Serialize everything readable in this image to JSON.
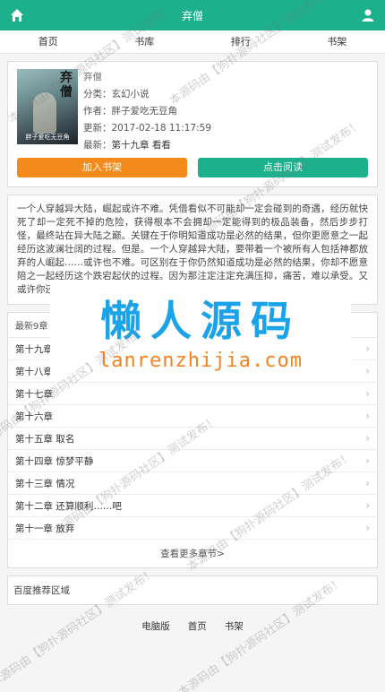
{
  "header": {
    "title": "弃僧",
    "home_icon": "home-icon",
    "user_icon": "user-icon"
  },
  "nav": {
    "items": [
      {
        "label": "首页"
      },
      {
        "label": "书库"
      },
      {
        "label": "排行"
      },
      {
        "label": "书架"
      }
    ]
  },
  "book": {
    "cover_title": "弃僧",
    "cover_author": "胖子爱吃无豆角",
    "name": "弃僧",
    "category": "分类：玄幻小说",
    "author": "作者：胖子爱吃无豆角",
    "updated": "更新：2017-02-18 11:17:59",
    "latest_label": "最新：",
    "latest_chapter": "第十九章 看看",
    "btn_add_shelf": "加入书架",
    "btn_read": "点击阅读"
  },
  "intro": "一个人穿越异大陆，崛起或许不难。凭借看似不可能却一定会碰到的奇遇，经历就快死了却一定死不掉的危险，获得根本不会拥却一定能得到的极品装备，然后步步打怪，最终站在异大陆之巅。关键在于你明知道成功是必然的结果，但你更愿意之一起经历这波澜壮阔的过程。但是。一个人穿越异大陆，要带着一个被所有人包括神都放弃的人崛起……或许也不难。可区别在于你仍然知道成功是必然的结果，你却不愿意陪之一起经历这个跌宕起伏的过程。因为那注定注定充满压抑，痛苦，难以承受。又或许你还是愿将精力情感投入这样一本不值得？那么，要不要试试呢？",
  "chapters": {
    "head": "最新9章",
    "items": [
      {
        "title": "第十九章 看看"
      },
      {
        "title": "第十八章"
      },
      {
        "title": "第十七章"
      },
      {
        "title": "第十六章"
      },
      {
        "title": "第十五章 取名"
      },
      {
        "title": "第十四章 惊梦平静"
      },
      {
        "title": "第十三章 情况"
      },
      {
        "title": "第十二章 还算顺利……吧"
      },
      {
        "title": "第十一章 放弃"
      }
    ],
    "more": "查看更多章节>"
  },
  "ad_area": "百度推荐区域",
  "footer": {
    "links": [
      {
        "label": "电脑版"
      },
      {
        "label": "首页"
      },
      {
        "label": "书架"
      }
    ]
  },
  "watermark": {
    "big": "懒人源码",
    "small": "lanrenzhijia.com",
    "diagonal": "本源码由【狗扑源码社区】测试发布！"
  }
}
